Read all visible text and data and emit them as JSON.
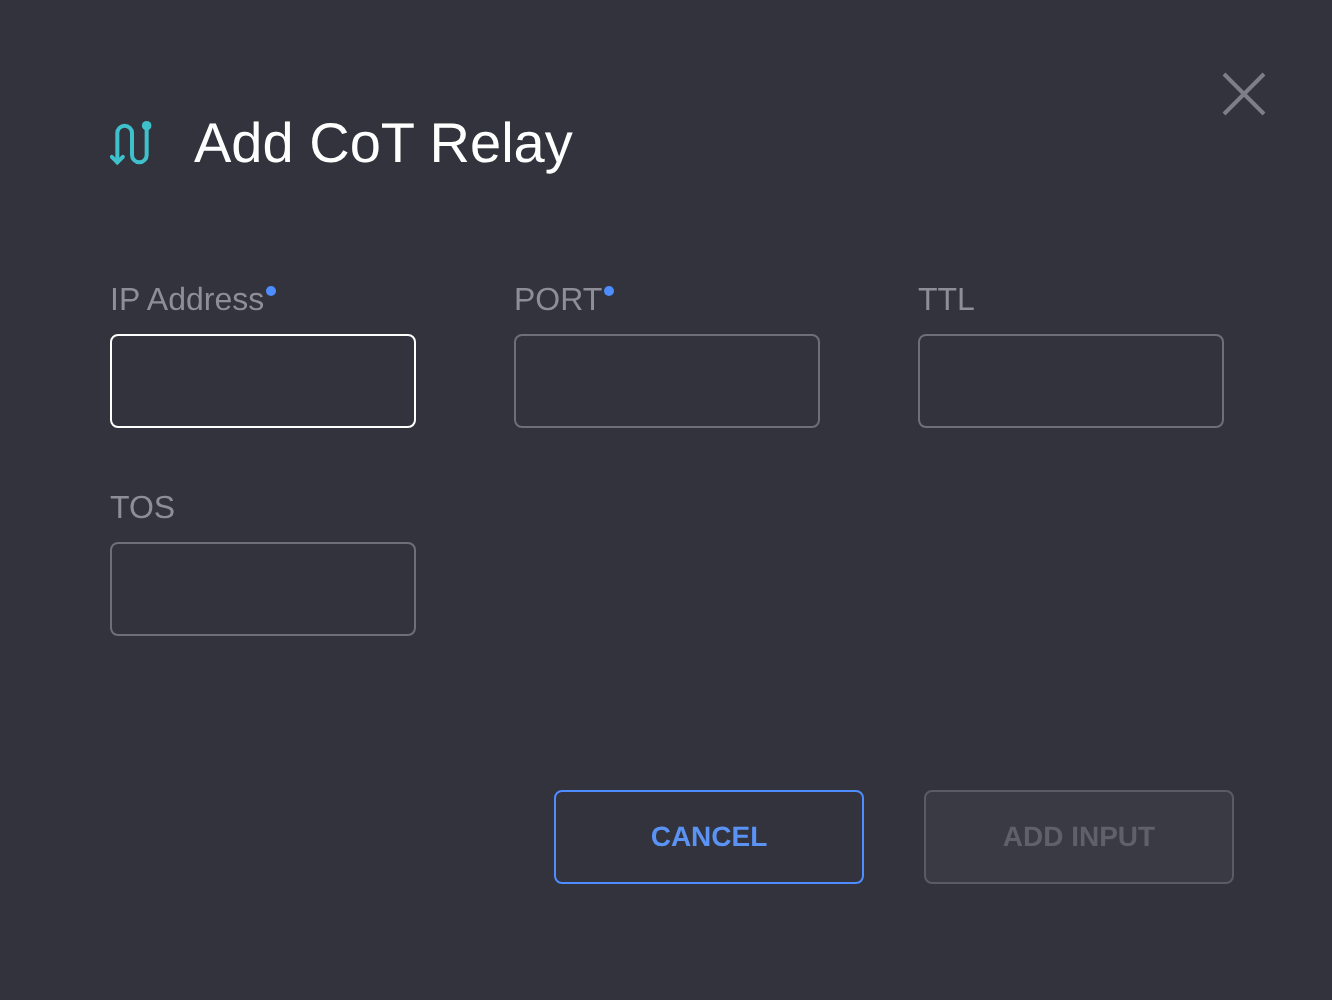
{
  "dialog": {
    "title": "Add CoT Relay"
  },
  "fields": [
    {
      "label": "IP Address",
      "required": true,
      "focused": true
    },
    {
      "label": "PORT",
      "required": true,
      "focused": false
    },
    {
      "label": "TTL",
      "required": false,
      "focused": false
    },
    {
      "label": "TOS",
      "required": false,
      "focused": false
    }
  ],
  "buttons": [
    {
      "label": "CANCEL",
      "disabled": false
    },
    {
      "label": "ADD INPUT",
      "disabled": true
    }
  ]
}
